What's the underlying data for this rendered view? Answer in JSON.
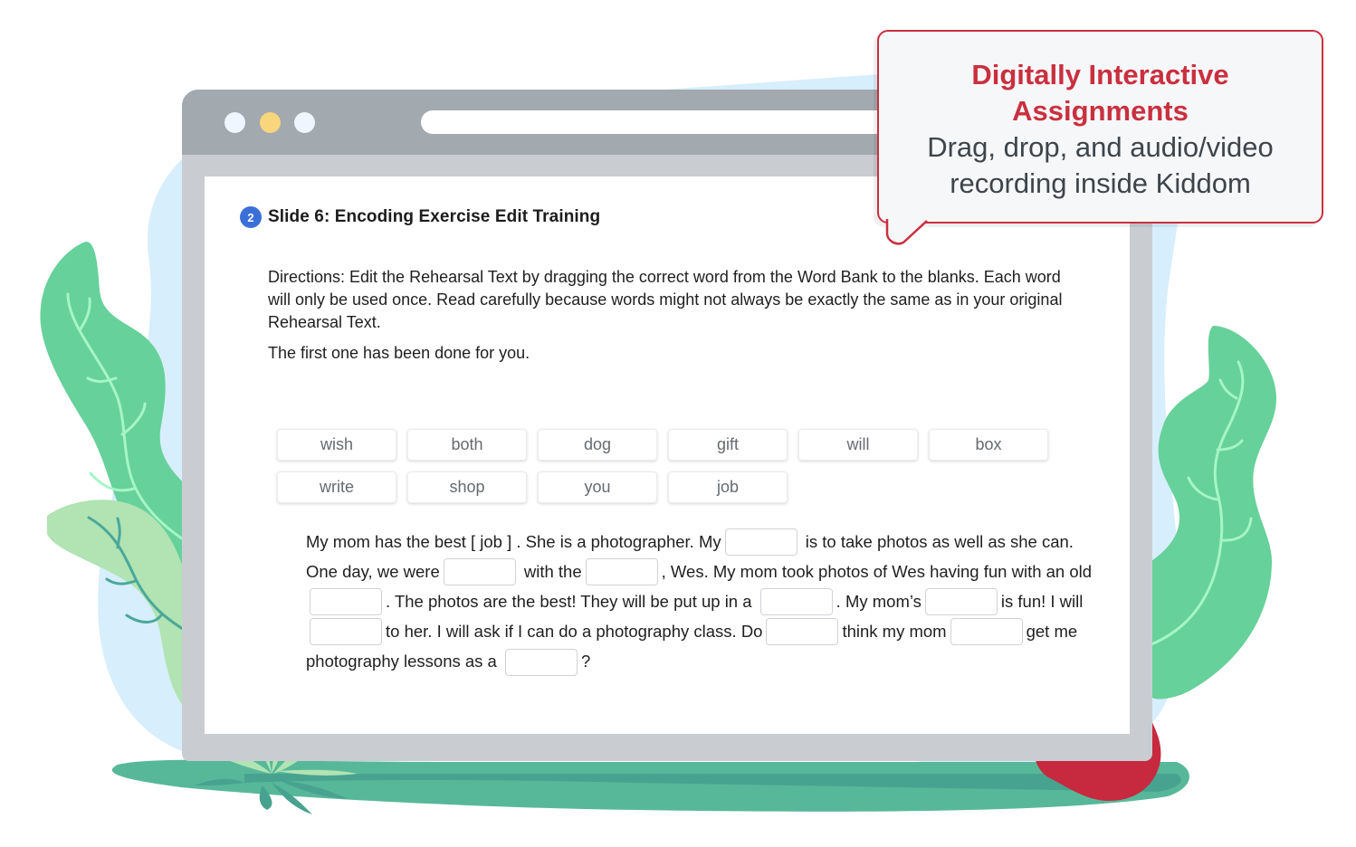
{
  "browser": {
    "window_controls": [
      "close",
      "minimize",
      "maximize"
    ],
    "url": ""
  },
  "slide": {
    "step_number": "2",
    "title": "Slide 6: Encoding Exercise Edit Training",
    "directions": "Directions: Edit the Rehearsal Text by dragging the correct word from the Word Bank to the blanks. Each word will only be used once. Read carefully because words might not always be exactly the same as in your original Rehearsal Text.",
    "note": "The first one has been done for you."
  },
  "word_bank": [
    "wish",
    "both",
    "dog",
    "gift",
    "will",
    "box",
    "write",
    "shop",
    "you",
    "job"
  ],
  "passage": {
    "segments": [
      "My mom has the best [ job ] . She is a photographer. My",
      "is to take photos as well as she can. One day, we were",
      "with the",
      ", Wes. My mom took photos of Wes having fun with an old",
      ". The photos are the best! They will be put up in a",
      ". My mom’s",
      "is fun! I will",
      "to her. I will ask if I can do a photography class. Do",
      "think my mom",
      "get me photography lessons as a",
      "?"
    ],
    "blank_values": [
      "",
      "",
      "",
      "",
      "",
      "",
      "",
      "",
      "",
      ""
    ]
  },
  "callout": {
    "title": "Digitally Interactive Assignments",
    "subtitle": "Drag, drop, and audio/video recording inside Kiddom"
  },
  "colors": {
    "accent_red": "#c9303f",
    "badge_blue": "#3b6fd8",
    "leaf_green": "#66d19a",
    "light_leaf": "#b1e3b3",
    "ground_green": "#57b899",
    "sky_blue": "#d7eefc",
    "apple_red": "#c7293f"
  }
}
